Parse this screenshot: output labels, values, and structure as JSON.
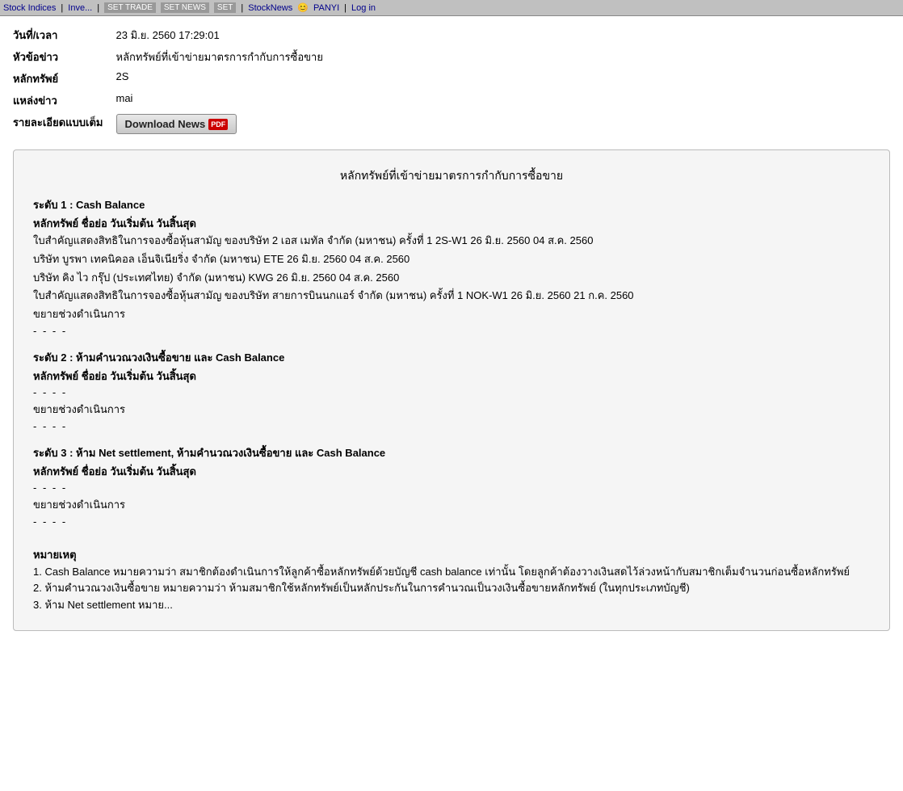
{
  "topbar": {
    "links": [
      "Stock Indices",
      "Inve...",
      "SET TRADE",
      "SET NEWS",
      "SET",
      "StockNews",
      "PANYI",
      "Log in"
    ]
  },
  "info": {
    "date_label": "วันที่/เวลา",
    "date_value": "23 มิ.ย. 2560 17:29:01",
    "headline_label": "หัวข้อข่าว",
    "headline_value": "หลักทรัพย์ที่เข้าข่ายมาตรการกำกับการซื้อขาย",
    "security_label": "หลักทรัพย์",
    "security_value": "2S",
    "source_label": "แหล่งข่าว",
    "source_value": "mai",
    "detail_label": "รายละเอียดแบบเต็ม",
    "download_btn": "Download News",
    "pdf_label": "PDF"
  },
  "main_box": {
    "title": "หลักทรัพย์ที่เข้าข่ายมาตรการกำกับการซื้อขาย",
    "section1_title": "ระดับ 1 : Cash Balance",
    "section1_cols": "หลักทรัพย์    ชื่อย่อ    วันเริ่มต้น    วันสิ้นสุด",
    "section1_line1": "ใบสำคัญแสดงสิทธิในการจองซื้อหุ้นสามัญ ของบริษัท 2 เอส เมทัล จำกัด (มหาชน) ครั้งที่ 1    2S-W1    26 มิ.ย. 2560    04 ส.ค. 2560",
    "section1_line2": "บริษัท บูรพา เทคนิคอล เอ็นจิเนียริ่ง จำกัด (มหาชน)    ETE    26 มิ.ย. 2560    04 ส.ค. 2560",
    "section1_line3": "บริษัท คิง ไว กรุ๊ป (ประเทศไทย) จำกัด (มหาชน)    KWG    26 มิ.ย. 2560    04 ส.ค. 2560",
    "section1_line4": "ใบสำคัญแสดงสิทธิในการจองซื้อหุ้นสามัญ ของบริษัท สายการบินนกแอร์ จำกัด (มหาชน) ครั้งที่ 1    NOK-W1    26 มิ.ย. 2560    21 ก.ค. 2560",
    "section1_expand": "ขยายช่วงดำเนินการ",
    "section1_dashes": "-    -    -    -",
    "section2_title": "ระดับ 2 : ห้ามคำนวณวงเงินซื้อขาย  และ Cash Balance",
    "section2_cols": "หลักทรัพย์    ชื่อย่อ    วันเริ่มต้น    วันสิ้นสุด",
    "section2_dashes": "-    -    -    -",
    "section2_expand": "ขยายช่วงดำเนินการ",
    "section2_dashes2": "-    -    -    -",
    "section3_title": "ระดับ 3 : ห้าม Net settlement, ห้ามคำนวณวงเงินซื้อขาย  และ Cash Balance",
    "section3_cols": "หลักทรัพย์    ชื่อย่อ    วันเริ่มต้น    วันสิ้นสุด",
    "section3_dashes": "-    -    -    -",
    "section3_expand": "ขยายช่วงดำเนินการ",
    "section3_dashes2": "-    -    -    -",
    "note_title": "หมายเหตุ",
    "note1": "1. Cash Balance หมายความว่า สมาชิกต้องดำเนินการให้ลูกค้าซื้อหลักทรัพย์ด้วยบัญชี cash balance เท่านั้น โดยลูกค้าต้องวางเงินสดไว้ล่วงหน้ากับสมาชิกเต็มจำนวนก่อนซื้อหลักทรัพย์",
    "note2": "2. ห้ามคำนวณวงเงินซื้อขาย หมายความว่า ห้ามสมาชิกใช้หลักทรัพย์เป็นหลักประกันในการคำนวณเป็นวงเงินซื้อขายหลักทรัพย์ (ในทุกประเภทบัญชี)",
    "note3": "3. ห้าม Net settlement หมาย..."
  }
}
